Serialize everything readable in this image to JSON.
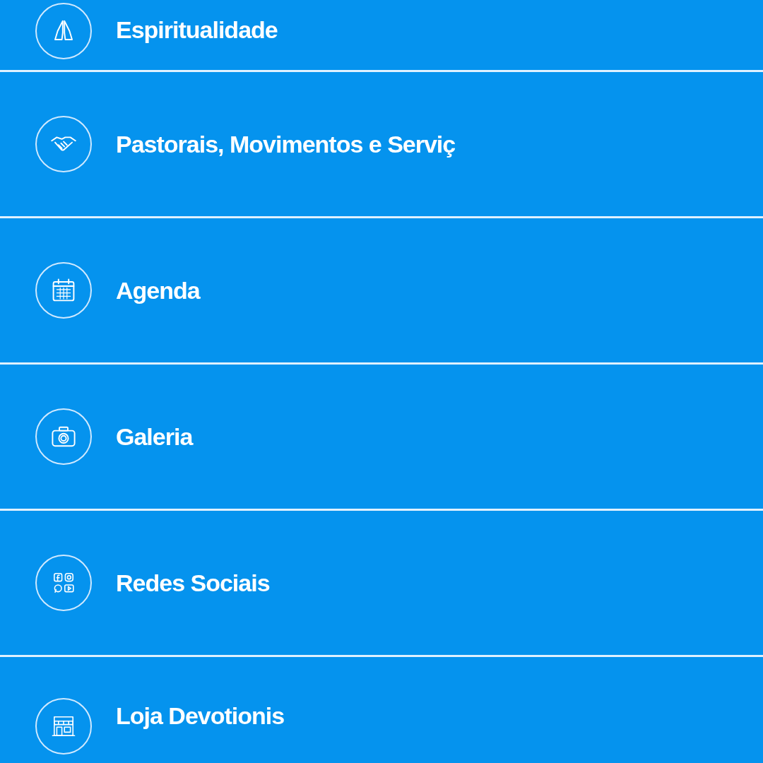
{
  "menu": {
    "items": [
      {
        "label": "Espiritualidade"
      },
      {
        "label": "Pastorais, Movimentos e Serviç"
      },
      {
        "label": "Agenda"
      },
      {
        "label": "Galeria"
      },
      {
        "label": "Redes Sociais"
      },
      {
        "label": "Loja Devotionis"
      }
    ]
  }
}
